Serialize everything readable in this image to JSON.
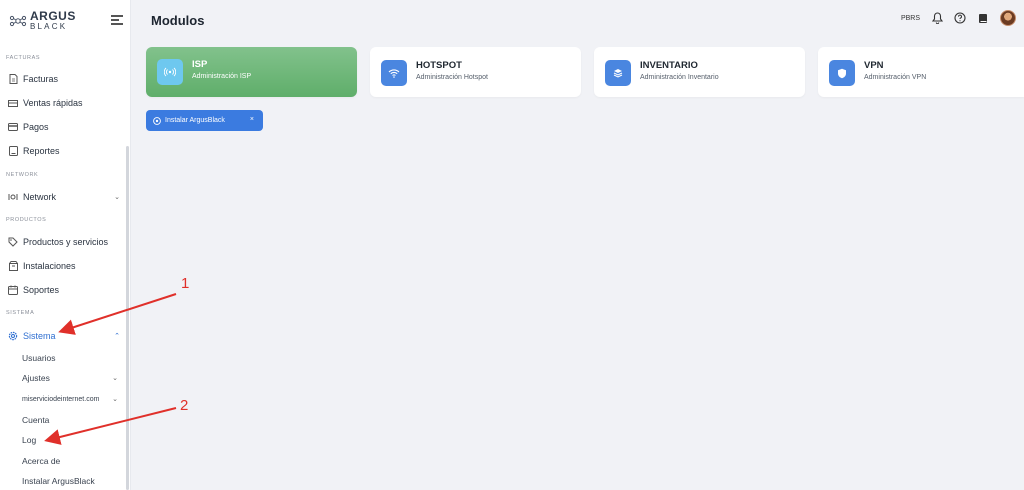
{
  "brand": {
    "line1": "ARGUS",
    "line2": "BLACK"
  },
  "page_title": "Modulos",
  "topbar": {
    "user_code": "PBRS"
  },
  "sidebar": {
    "sections": {
      "facturas": "FACTURAS",
      "network": "NETWORK",
      "productos": "PRODUCTOS",
      "sistema": "SISTEMA"
    },
    "items": {
      "facturas": "Facturas",
      "ventas": "Ventas rápidas",
      "pagos": "Pagos",
      "reportes": "Reportes",
      "network": "Network",
      "productos": "Productos y servicios",
      "instalaciones": "Instalaciones",
      "soportes": "Soportes",
      "sistema": "Sistema"
    },
    "sub_items": {
      "usuarios": "Usuarios",
      "ajustes": "Ajustes",
      "dominio": "miserviciodeinternet.com",
      "cuenta": "Cuenta",
      "log": "Log",
      "acerca": "Acerca de",
      "instalar": "Instalar ArgusBlack"
    }
  },
  "cards": [
    {
      "title": "ISP",
      "subtitle": "Administración ISP",
      "icon": "antenna-icon"
    },
    {
      "title": "HOTSPOT",
      "subtitle": "Administración Hotspot",
      "icon": "wifi-icon"
    },
    {
      "title": "INVENTARIO",
      "subtitle": "Administración Inventario",
      "icon": "layers-icon"
    },
    {
      "title": "VPN",
      "subtitle": "Administración VPN",
      "icon": "shield-icon"
    }
  ],
  "install_chip": {
    "label": "Instalar ArgusBlack",
    "close": "×"
  },
  "annotations": {
    "one": "1",
    "two": "2"
  },
  "colors": {
    "accent": "#3b7be0",
    "active_card": "#6bb876",
    "arrow": "#e0302a"
  }
}
